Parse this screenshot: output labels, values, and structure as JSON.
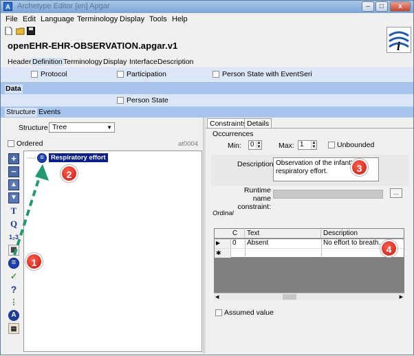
{
  "window": {
    "title": "Archetype Editor [en] Apgar",
    "min_label": "–",
    "max_label": "□",
    "close_label": "x"
  },
  "menu": [
    "File",
    "Edit",
    "Language",
    "Terminology",
    "Display",
    "Tools",
    "Help"
  ],
  "archetype_id": "openEHR-EHR-OBSERVATION.apgar.v1",
  "main_tabs": [
    "Header",
    "Definition",
    "Terminology",
    "Display",
    "Interface",
    "Description"
  ],
  "sections": {
    "protocol": "Protocol",
    "participation": "Participation",
    "person_state_event": "Person State with EventSeri",
    "data_tab": "Data",
    "person_state": "Person State"
  },
  "structure_tabs": [
    "Structure",
    "Events"
  ],
  "structure": {
    "label": "Structure",
    "value": "Tree",
    "ordered_label": "Ordered",
    "node_code": "at0004",
    "tree_node": "Respiratory effort"
  },
  "toolbox_icons": [
    "add-icon",
    "remove-icon",
    "move-up-icon",
    "move-down-icon",
    "text-icon",
    "quantity-icon",
    "count-icon",
    "datetime-icon",
    "ordinal-icon",
    "boolean-icon",
    "any-icon",
    "slot-icon",
    "multimedia-icon",
    "uri-icon"
  ],
  "constraint_tabs": [
    "Constraints",
    "Details"
  ],
  "occurrences": {
    "label": "Occurrences",
    "min_label": "Min:",
    "min_value": "0",
    "max_label": "Max:",
    "max_value": "1",
    "unbounded_label": "Unbounded"
  },
  "description": {
    "label": "Description",
    "value": "Observation of the infant's respiratory effort."
  },
  "runtime": {
    "label": "Runtime name constraint:",
    "button": "..."
  },
  "ordinal_label": "Ordinal",
  "ordinal_table": {
    "columns": [
      "C",
      "Text",
      "Description"
    ],
    "rows": [
      {
        "code": "0",
        "text": "Absent",
        "description": "No effort to breath."
      }
    ]
  },
  "assumed_value_label": "Assumed value",
  "callouts": [
    "1",
    "2",
    "3",
    "4"
  ],
  "colors": {
    "band_dark": "#a6c4ec",
    "band_light": "#dbe6f6",
    "tree_node": "#0a1f8f",
    "callout": "#d9281a",
    "arrow": "#1e9a6e"
  }
}
